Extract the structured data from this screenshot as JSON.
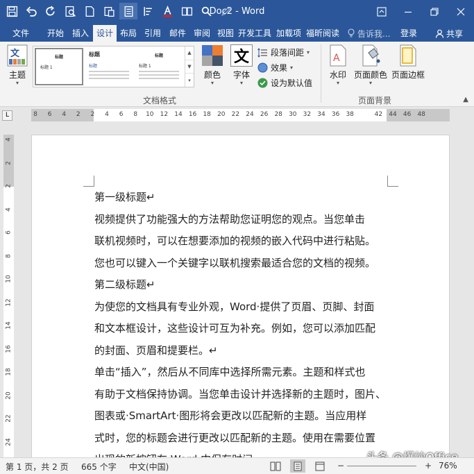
{
  "window": {
    "title": "Doc2 - Word"
  },
  "tabs": [
    {
      "label": "文件",
      "active": false
    },
    {
      "label": "开始",
      "active": false
    },
    {
      "label": "插入",
      "active": false
    },
    {
      "label": "设计",
      "active": true
    },
    {
      "label": "布局",
      "active": false
    },
    {
      "label": "引用",
      "active": false
    },
    {
      "label": "邮件",
      "active": false
    },
    {
      "label": "审阅",
      "active": false
    },
    {
      "label": "视图",
      "active": false
    },
    {
      "label": "开发工具",
      "active": false
    },
    {
      "label": "加载项",
      "active": false
    },
    {
      "label": "福昕阅读",
      "active": false
    }
  ],
  "tellme": {
    "placeholder": "告诉我..."
  },
  "account": {
    "login": "登录",
    "share": "共享"
  },
  "ribbon": {
    "theme_label": "主题",
    "gallery": {
      "thumb1": {
        "title": "标题",
        "heading": "标题 1"
      },
      "thumb2": {
        "title": "标题",
        "heading": "标题"
      },
      "thumb3": {
        "title": "标题",
        "heading": "标题 1"
      }
    },
    "colors_label": "颜色",
    "fonts_label": "字体",
    "fonts_glyph": "文",
    "paragraph_spacing_label": "段落间距",
    "effects_label": "效果",
    "set_default_label": "设为默认值",
    "doc_format_group": "文档格式",
    "watermark_label": "水印",
    "page_color_label": "页面颜色",
    "page_border_label": "页面边框",
    "page_background_group": "页面背景"
  },
  "ruler": {
    "corner": "L",
    "h_numbers": [
      "8",
      "6",
      "4",
      "2",
      "2",
      "4",
      "6",
      "8",
      "10",
      "12",
      "14",
      "16",
      "18",
      "20",
      "22",
      "24",
      "26",
      "28",
      "30",
      "32",
      "34",
      "36",
      "38",
      "42",
      "44",
      "46",
      "48"
    ],
    "v_numbers": [
      "4",
      "2",
      "2",
      "4",
      "6",
      "8",
      "10",
      "12",
      "14",
      "16",
      "18",
      "20",
      "22",
      "24"
    ]
  },
  "document": {
    "paragraphs": [
      "第一级标题↵",
      "视频提供了功能强大的方法帮助您证明您的观点。当您单击",
      "联机视频时，可以在想要添加的视频的嵌入代码中进行粘贴。",
      "您也可以键入一个关键字以联机搜索最适合您的文档的视频。",
      "第二级标题↵",
      "为使您的文档具有专业外观，Word·提供了页眉、页脚、封面",
      "和文本框设计，这些设计可互为补充。例如，您可以添加匹配",
      "的封面、页眉和提要栏。↵",
      "单击“插入”，然后从不同库中选择所需元素。主题和样式也",
      "有助于文档保持协调。当您单击设计并选择新的主题时，图片、",
      "图表或·SmartArt·图形将会更改以匹配新的主题。当应用样",
      "式时，您的标题会进行更改以匹配新的主题。使用在需要位置",
      "出现的新按钮在·Word·中保存时间。"
    ]
  },
  "status": {
    "page": "第 1 页，共 2 页",
    "words": "665 个字",
    "language": "中文(中国)",
    "zoom": "76%"
  },
  "watermark_text": "头条 @爆炒Office",
  "colors": {
    "brand": "#2b579a"
  }
}
